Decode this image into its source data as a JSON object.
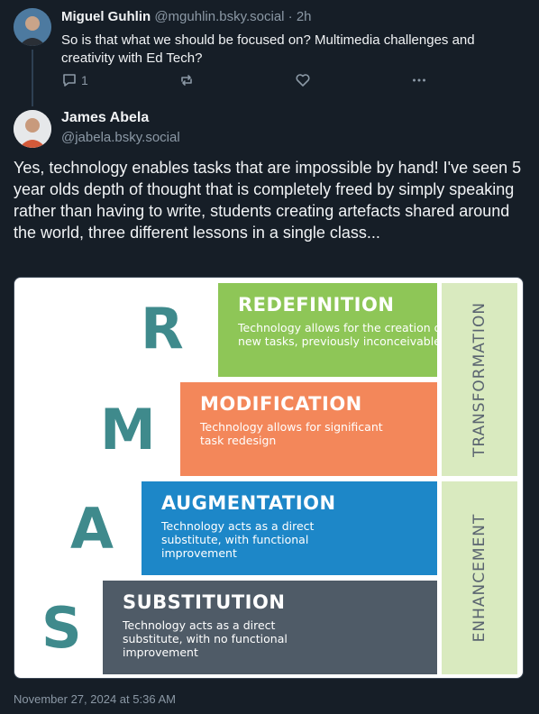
{
  "reply": {
    "author_name": "Miguel Guhlin",
    "author_handle": "@mguhlin.bsky.social",
    "time_sep": "·",
    "time": "2h",
    "text": "So is that what we should be focused on? Multimedia challenges and creativity with Ed Tech?",
    "reply_count": "1"
  },
  "post": {
    "author_name": "James Abela",
    "author_handle": "@jabela.bsky.social",
    "text": "Yes, technology enables tasks that are impossible by hand! I've seen 5 year olds depth of thought that is completely freed by simply speaking rather than having to write, students creating artefacts shared around the world, three different lessons in a single class...",
    "timestamp": "November 27, 2024 at 5:36 AM"
  },
  "samr": {
    "letters": [
      "R",
      "M",
      "A",
      "S"
    ],
    "levels": [
      {
        "title": "REDEFINITION",
        "desc": "Technology allows for the creation of new tasks, previously inconceivable",
        "color": "#8ec657"
      },
      {
        "title": "MODIFICATION",
        "desc": "Technology allows for significant task redesign",
        "color": "#f3875a"
      },
      {
        "title": "AUGMENTATION",
        "desc": "Technology acts as a direct substitute, with functional improvement",
        "color": "#1d87c8"
      },
      {
        "title": "SUBSTITUTION",
        "desc": "Technology acts as a direct substitute, with no functional improvement",
        "color": "#4f5b67"
      }
    ],
    "groups": [
      "TRANSFORMATION",
      "ENHANCEMENT"
    ],
    "letter_color": "#3f8a8c",
    "group_color": "#d9eabf"
  },
  "icons": [
    "reply-icon",
    "repost-icon",
    "like-icon",
    "more-icon"
  ]
}
